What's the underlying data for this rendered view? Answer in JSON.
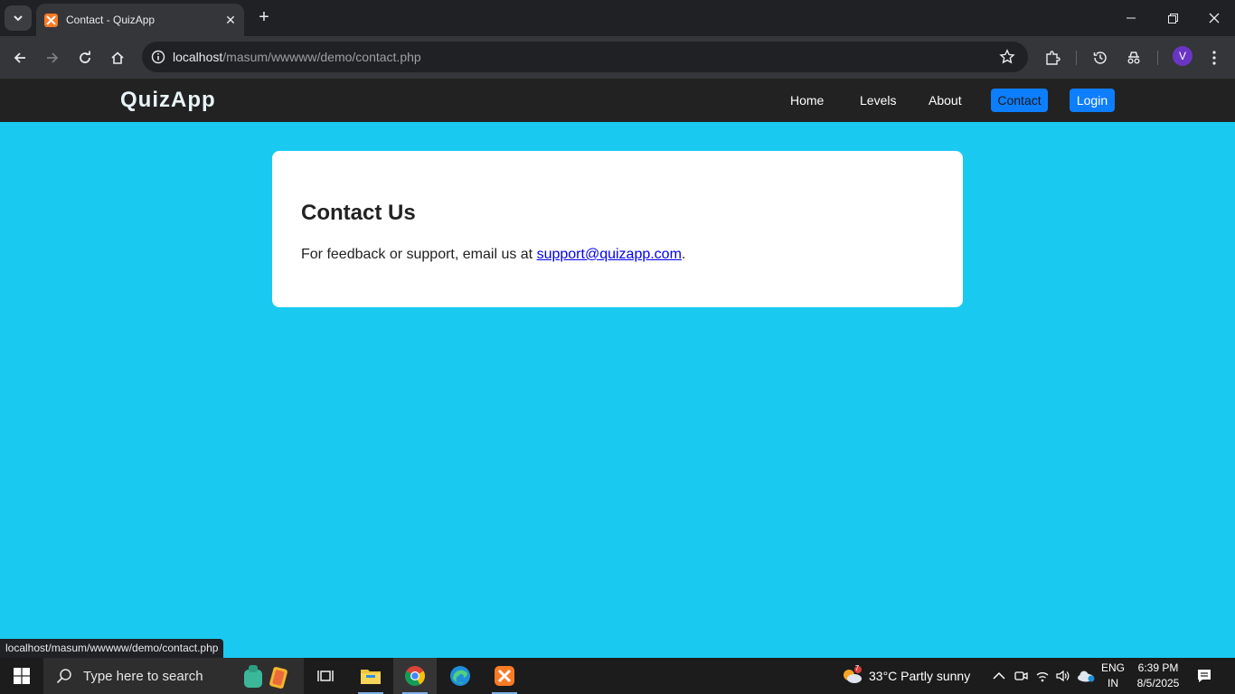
{
  "browser": {
    "tab_title": "Contact - QuizApp",
    "url_host": "localhost",
    "url_path": "/masum/wwwww/demo/contact.php",
    "profile_initial": "V",
    "status_url": "localhost/masum/wwwww/demo/contact.php"
  },
  "site": {
    "brand": "QuizApp",
    "nav": {
      "home": "Home",
      "levels": "Levels",
      "about": "About",
      "contact": "Contact",
      "login": "Login"
    },
    "colors": {
      "nav_bg": "#222222",
      "page_bg": "#1ac9f0",
      "accent": "#0d7efd"
    }
  },
  "contact": {
    "heading": "Contact Us",
    "text_before": "For feedback or support, email us at ",
    "email": "support@quizapp.com",
    "text_after": "."
  },
  "taskbar": {
    "search_placeholder": "Type here to search",
    "weather_badge": "7",
    "weather": "33°C  Partly sunny",
    "lang_line1": "ENG",
    "lang_line2": "IN",
    "time": "6:39 PM",
    "date": "8/5/2025"
  }
}
